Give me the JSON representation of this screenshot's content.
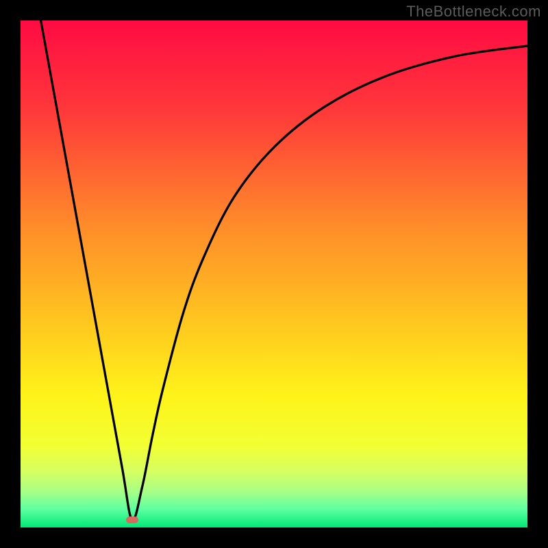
{
  "watermark": "TheBottleneck.com",
  "chart_data": {
    "type": "line",
    "title": "",
    "xlabel": "",
    "ylabel": "",
    "xlim": [
      0,
      100
    ],
    "ylim": [
      0,
      100
    ],
    "marker": {
      "x": 22,
      "y": 1.5
    },
    "series": [
      {
        "name": "curve",
        "x": [
          4,
          10,
          16,
          20,
          22,
          24,
          26,
          28,
          32,
          36,
          42,
          50,
          60,
          72,
          86,
          100
        ],
        "y": [
          100,
          67,
          34,
          12,
          1.5,
          8,
          18,
          27,
          42,
          53,
          65,
          75,
          83,
          89,
          93,
          95
        ]
      }
    ],
    "gradient_stops": [
      {
        "offset": 0.0,
        "color": "#ff0b43"
      },
      {
        "offset": 0.18,
        "color": "#ff393a"
      },
      {
        "offset": 0.4,
        "color": "#ff8a2a"
      },
      {
        "offset": 0.6,
        "color": "#ffc81f"
      },
      {
        "offset": 0.74,
        "color": "#fff31a"
      },
      {
        "offset": 0.84,
        "color": "#f2ff33"
      },
      {
        "offset": 0.89,
        "color": "#d5ff62"
      },
      {
        "offset": 0.93,
        "color": "#a6ff87"
      },
      {
        "offset": 0.965,
        "color": "#5bffa0"
      },
      {
        "offset": 1.0,
        "color": "#00e876"
      }
    ]
  }
}
